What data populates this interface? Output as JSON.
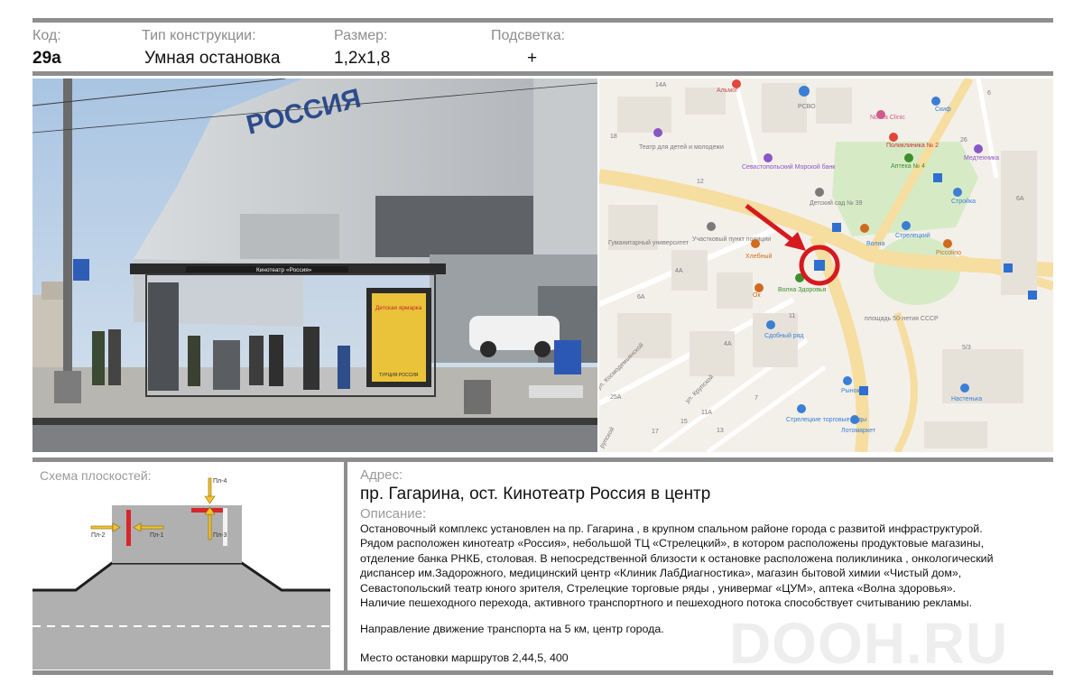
{
  "header": {
    "code_label": "Код:",
    "type_label": "Тип конструкции:",
    "size_label": "Размер:",
    "light_label": "Подсветка:",
    "code_value": "29а",
    "type_value": "Умная остановка",
    "size_value": "1,2x1,8",
    "light_value": "+"
  },
  "photo": {
    "cinema_sign": "РОССИЯ",
    "shelter_sign": "Кинотеатр «Россия»",
    "poster_title": "Детская ярмарка",
    "poster_sub": "ТУРЦИЯ РОССИЯ"
  },
  "map": {
    "labels": {
      "a14a": "14А",
      "almog": "Альмог",
      "rsvo": "РСВО",
      "novva": "Novva Clinic",
      "skif": "Скиф",
      "n6": "6",
      "n18": "18",
      "teatr": "Театр для детей и молодежи",
      "poli": "Поликлиника № 2",
      "apteka4": "Аптека № 4",
      "n26": "26",
      "medtech": "Медтехника",
      "n12": "12",
      "bank": "Севастопольский Морской банк",
      "sad": "Детский сад № 39",
      "stroyka": "Стройка",
      "n6a": "6А",
      "univer": "Гуманитарный университет",
      "punkt": "Участковый пункт полиции",
      "hlebny": "Хлебный",
      "volna": "Волна",
      "strel": "Стрелецкий",
      "piccolino": "Piccolino",
      "n4a": "4А",
      "ok": "Ок",
      "volna_zdor": "Волна Здоровья",
      "n6a2": "6А",
      "sdobny": "Сдобный ряд",
      "ploshad": "площадь 50-летия СССР",
      "n11": "11",
      "n4a2": "4А",
      "n53": "5/3",
      "kosmo": "ул. Космодемьянской",
      "krupsk": "ул. Крупской",
      "n25a": "25А",
      "rynok": "Рынок",
      "nastenka": "Настенька",
      "strel_ryady": "Стрелецкие торговые ряды",
      "lotomarket": "Лотомаркет",
      "n17": "17",
      "n15": "15",
      "n11a": "11А",
      "n13": "13",
      "n7": "7",
      "krupsk2": "рупской"
    }
  },
  "scheme": {
    "title": "Схема плоскостей:",
    "p1": "Пл-1",
    "p2": "Пл-2",
    "p3": "Пл-3",
    "p4": "Пл-4"
  },
  "address": {
    "label": "Адрес:",
    "value": "пр. Гагарина, ост. Кинотеатр Россия в центр"
  },
  "description": {
    "label": "Описание:",
    "text": "Остановочный комплекс установлен на пр. Гагарина , в крупном спальном районе города  с развитой инфраструктурой.\nРядом расположен  кинотеатр «Россия», небольшой  ТЦ «Стрелецкий», в котором расположены продуктовые магазины,\nотделение банка РНКБ, столовая. В непосредственной близости к остановке расположена поликлиника , онкологический\nдиспансер им.Задорожного, медицинский центр «Клиник ЛабДиагностика», магазин бытовой химии «Чистый дом»,\nСевастопольский театр юного зрителя,  Стрелецкие торговые ряды , универмаг «ЦУМ», аптека «Волна здоровья».\nНаличие пешеходного перехода, активного транспортного и пешеходного потока способствует    считыванию рекламы.",
    "direction": "Направление движение транспорта на 5 км, центр города.",
    "routes": "Место остановки маршрутов 2,44,5, 400"
  },
  "watermark": "DOOH.RU",
  "colors": {
    "rule": "#8e8e8e",
    "label": "#8c8c8c",
    "marker_red": "#d6191f",
    "arrow_yellow": "#f2c230",
    "panel_red": "#d8262b",
    "road": "#b0b0b0"
  }
}
